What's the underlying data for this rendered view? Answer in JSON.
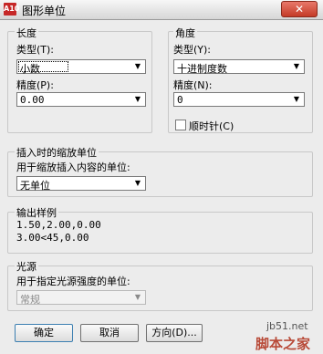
{
  "window": {
    "app_icon_text": "A10",
    "title": "图形单位",
    "close_glyph": "✕",
    "accent_color": "#c43b28"
  },
  "length": {
    "group_title": "长度",
    "type_label": "类型(T):",
    "type_value": "小数",
    "precision_label": "精度(P):",
    "precision_value": "0.00"
  },
  "angle": {
    "group_title": "角度",
    "type_label": "类型(Y):",
    "type_value": "十进制度数",
    "precision_label": "精度(N):",
    "precision_value": "0",
    "clockwise_label": "顺时针(C)",
    "clockwise_checked": false
  },
  "insertion": {
    "group_title": "插入时的缩放单位",
    "desc": "用于缩放插入内容的单位:",
    "value": "无单位"
  },
  "sample": {
    "group_title": "输出样例",
    "line1": "1.50,2.00,0.00",
    "line2": "3.00<45,0.00"
  },
  "lighting": {
    "group_title": "光源",
    "desc": "用于指定光源强度的单位:",
    "value": "常规"
  },
  "buttons": {
    "ok": "确定",
    "cancel": "取消",
    "direction": "方向(D)..."
  },
  "watermark": {
    "site": "jb51.net",
    "brand": "脚本之家"
  }
}
